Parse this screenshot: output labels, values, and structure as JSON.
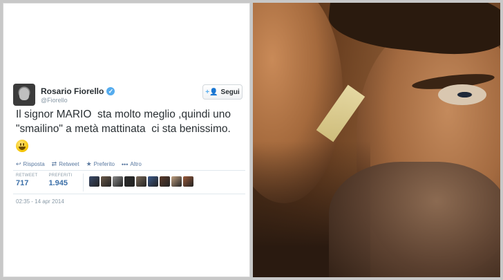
{
  "tweet": {
    "author_name": "Rosario Fiorello",
    "handle": "@Fiorello",
    "follow_label": "Segui",
    "text": "Il signor MARIO  sta molto meglio ,quindi uno\n\"smailino\" a metà mattinata  ci sta benissimo.",
    "emoji": "smiley-emoji",
    "actions": [
      {
        "label": "Risposta",
        "icon": "reply-icon",
        "glyph": "↩"
      },
      {
        "label": "Retweet",
        "icon": "retweet-icon",
        "glyph": "⇄"
      },
      {
        "label": "Preferito",
        "icon": "star-icon",
        "glyph": "★"
      },
      {
        "label": "Altro",
        "icon": "more-icon",
        "glyph": "•••"
      }
    ],
    "stats": {
      "retweet_label": "RETWEET",
      "retweet_count": "717",
      "favorites_label": "PREFERITI",
      "favorites_count": "1.945"
    },
    "timestamp": "02:35 - 14 apr 2014",
    "favoriter_avatar_colors": [
      "#3a4a6a",
      "#6b5a4a",
      "#8a8a8a",
      "#2a2a2a",
      "#7a6a5a",
      "#3d5a8a",
      "#5a3a2a",
      "#c0a080",
      "#9a5a3a"
    ]
  },
  "photo": {
    "description_icon": "selfie-photo"
  },
  "colors": {
    "link": "#3b6fa8",
    "verified": "#55acee",
    "text": "#292f33",
    "muted": "#8899a6"
  }
}
